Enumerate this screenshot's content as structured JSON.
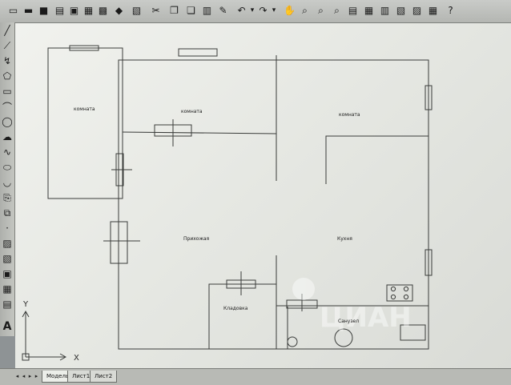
{
  "toolbar": {
    "icons": [
      "new-file",
      "open-folder",
      "save",
      "print",
      "preview",
      "plot",
      "cut",
      "copy",
      "paste",
      "match-properties",
      "undo",
      "dropdown-arrow",
      "redo",
      "dropdown-arrow",
      "pan",
      "zoom-realtime",
      "zoom-window",
      "zoom-previous",
      "properties",
      "design-center",
      "tool-palettes",
      "markup",
      "help"
    ]
  },
  "plan": {
    "rooms": {
      "room1": "комната",
      "room2": "комната",
      "room3": "комната",
      "hall": "Прихожая",
      "kitchen": "Кухня",
      "storage": "Кладовка",
      "bathroom": "Санузел"
    },
    "ucs": {
      "x_label": "X",
      "y_label": "Y"
    },
    "watermark": "ЦИАН"
  },
  "tabs": {
    "model": "Модель",
    "layout1": "Лист1",
    "layout2": "Лист2"
  }
}
